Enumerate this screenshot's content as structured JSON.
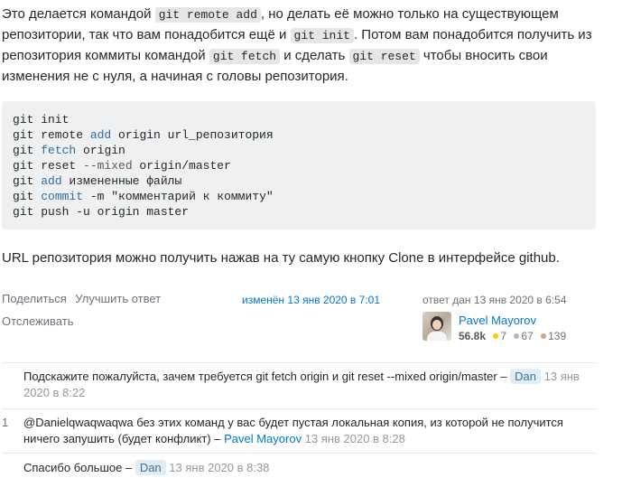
{
  "answer": {
    "p1": {
      "t1": "Это делается командой ",
      "c1": "git remote add",
      "t2": ", но делать её можно только на существующем репозитории, так что вам понадобится ещё и ",
      "c2": "git init",
      "t3": ". Потом вам понадобится получить из репозитория коммиты командой ",
      "c3": "git fetch",
      "t4": " и сделать ",
      "c4": "git reset",
      "t5": " чтобы вносить свои изменения не с нуля, а начиная с головы репозитория."
    },
    "code": {
      "l1": "git init",
      "l2a": "git remote ",
      "l2b": "add",
      "l2c": " origin url_репозитория",
      "l3a": "git ",
      "l3b": "fetch",
      "l3c": " origin",
      "l4a": "git reset ",
      "l4b": "--mixed",
      "l4c": " origin/master",
      "l5a": "git ",
      "l5b": "add",
      "l5c": " измененные файлы",
      "l6a": "git ",
      "l6b": "commit",
      "l6c": " -m ",
      "l6d": "\"комментарий к коммиту\"",
      "l7": "git push -u origin master"
    },
    "p2": "URL репозитория можно получить нажав на ту самую кнопку Clone в интерфейсе github."
  },
  "post_menu": {
    "share": "Поделиться",
    "improve": "Улучшить ответ",
    "follow": "Отслеживать"
  },
  "edited": "изменён 13 янв 2020 в 7:01",
  "answered": "ответ дан 13 янв 2020 в 6:54",
  "user": {
    "name": "Pavel Mayorov",
    "rep": "56.8k",
    "gold": "7",
    "silver": "67",
    "bronze": "139"
  },
  "colors": {
    "gold": "#ffcc01",
    "silver": "#b4b8bc",
    "bronze": "#d1a684"
  },
  "comments": [
    {
      "score": "",
      "text": "Подскажите пожалуйста, зачем требуется git fetch origin и git reset --mixed origin/master – ",
      "user": "Dan",
      "date": "13 янв 2020 в 8:22"
    },
    {
      "score": "1",
      "text": "@Danielqwaqwaqwa без этих команд у вас будет пустая локальная копия, из которой не получится ничего запушить (будет конфликт) – ",
      "user": "Pavel Mayorov",
      "date": "13 янв 2020 в 8:28"
    },
    {
      "score": "",
      "text": "Спасибо большое – ",
      "user": "Dan",
      "date": "13 янв 2020 в 8:38"
    }
  ]
}
